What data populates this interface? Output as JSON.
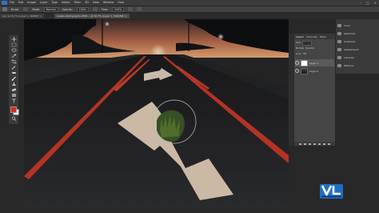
{
  "menubar": {
    "items": [
      "File",
      "Edit",
      "Image",
      "Layer",
      "Type",
      "Select",
      "Filter",
      "3D",
      "View",
      "Window",
      "Help"
    ],
    "window_controls": [
      "–",
      "□",
      "✕"
    ]
  },
  "options_bar": {
    "brush_label": "Brush:",
    "mode_label": "Mode:",
    "mode_value": "Normal",
    "opacity_label": "Opacity:",
    "opacity_value": "100%",
    "flow_label": "Flow:",
    "flow_value": "100%"
  },
  "document_tabs": {
    "tab1": "Lyic & 15.7% (Layer 1, RGB/8) ×",
    "tab2": "pexels-photography-2581... @ 16.7% (Layer 1, RGB/8#) ×"
  },
  "toolbox": {
    "foreground_color": "#d42d1f",
    "background_color": "#ffffff"
  },
  "layers_panel": {
    "tabs": [
      "Layers",
      "Channels",
      "Paths"
    ],
    "kind_label": "Kind",
    "blend_mode": "Normal",
    "opacity_label": "Opacity:",
    "lock_label": "Lock:",
    "fill_label": "Fill:",
    "layers": [
      {
        "name": "Layer 1"
      },
      {
        "name": "Layer 0"
      }
    ]
  },
  "properties_panel": {
    "items": [
      "Color",
      "Swatches",
      "Gradients",
      "Adjustments",
      "Libraries",
      "Patterns"
    ]
  },
  "canvas": {
    "description_colors": {
      "sky": "#d58a5c",
      "road": "#2a2a2a",
      "line": "#cf3b2a",
      "arrow": "#e8d4bf"
    }
  },
  "watermark": {
    "logo_text": "VL",
    "brand_color": "#1f6fc5"
  }
}
